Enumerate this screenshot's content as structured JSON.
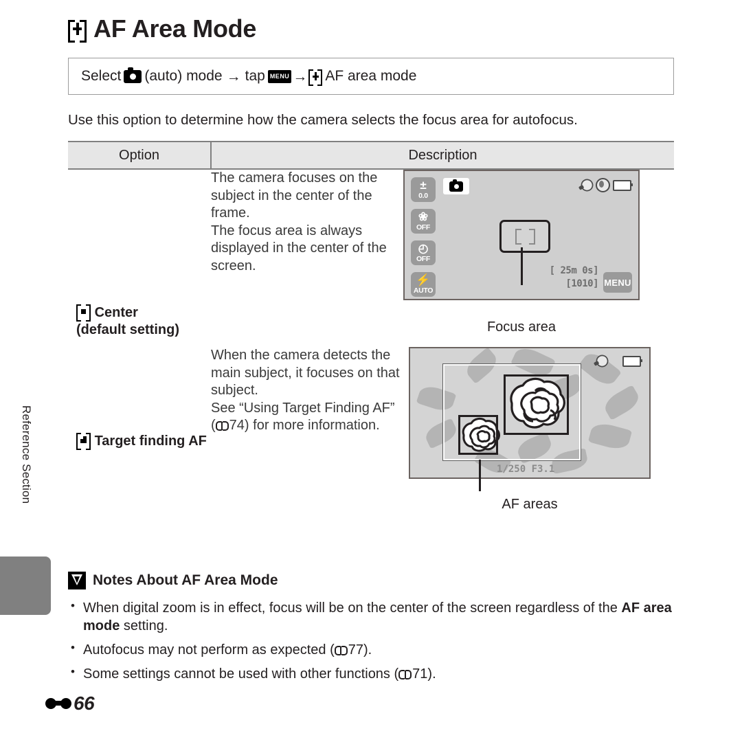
{
  "page": {
    "title": "AF Area Mode",
    "title_icon": "af-area-bracket-plus-icon",
    "side_tab_label": "Reference Section",
    "footer_number": "66",
    "footer_icon": "reference-section-symbol-icon"
  },
  "select_bar": {
    "prefix": "Select",
    "camera_icon": "camera-auto-mode-icon",
    "auto_label": "(auto) mode",
    "arrow": "→",
    "tap_label": "tap",
    "menu_icon_label": "MENU",
    "afarea_icon": "af-area-bracket-plus-icon",
    "suffix": "AF area mode"
  },
  "intro": "Use this option to determine how the camera selects the focus area for autofocus.",
  "table": {
    "headers": {
      "option": "Option",
      "description": "Description"
    },
    "rows": [
      {
        "option_icon": "center-af-icon",
        "option_label": "Center",
        "option_sub": "(default setting)",
        "description_lines": [
          "The camera focuses on the",
          "subject in the center of the",
          "frame.",
          "The focus area is always",
          "displayed in the center of the",
          "screen."
        ],
        "figure_caption": "Focus area"
      },
      {
        "option_icon": "target-finding-af-icon",
        "option_label": "Target finding AF",
        "option_sub": "",
        "description_lines": [
          "When the camera detects the",
          "main subject, it focuses on that",
          "subject.",
          "See “Using Target Finding AF”"
        ],
        "description_ref_prefix": "(",
        "description_ref_page": "74",
        "description_ref_suffix": ") for more information.",
        "figure_caption": "AF areas"
      }
    ]
  },
  "lcd_center": {
    "buttons": [
      {
        "name": "exposure-compensation-button",
        "glyph": "±",
        "label": "0.0"
      },
      {
        "name": "macro-mode-button",
        "glyph": "❀",
        "label": "OFF"
      },
      {
        "name": "self-timer-button",
        "glyph": "◴",
        "label": "OFF"
      },
      {
        "name": "flash-mode-button",
        "glyph": "⚡",
        "label": "AUTO"
      }
    ],
    "mode_badge_icon": "camera-auto-mode-icon",
    "status_icons": [
      "image-mode-icon",
      "vibration-reduction-icon",
      "battery-icon"
    ],
    "movie_time": "[ 25m 0s]",
    "shots_remaining": "[1010]",
    "menu_button_label": "MENU"
  },
  "lcd_target": {
    "exif": "1/250  F3.1",
    "status_icons": [
      "vibration-reduction-icon",
      "battery-icon"
    ]
  },
  "notes": {
    "icon": "caution-icon",
    "heading": "Notes About AF Area Mode",
    "items": [
      {
        "text_before": "When digital zoom is in effect, focus will be on the center of the screen regardless of the ",
        "bold": "AF area mode",
        "text_after": " setting."
      },
      {
        "text_before": "Autofocus may not perform as expected (",
        "ref_page": "77",
        "text_after": ")."
      },
      {
        "text_before": "Some settings cannot be used with other functions (",
        "ref_page": "71",
        "text_after": ")."
      }
    ]
  },
  "colors": {
    "table_rule": "#808080",
    "header_fill": "#e6e6e6",
    "lcd_bg": "#cfcfcf",
    "tab_gray": "#808080"
  }
}
